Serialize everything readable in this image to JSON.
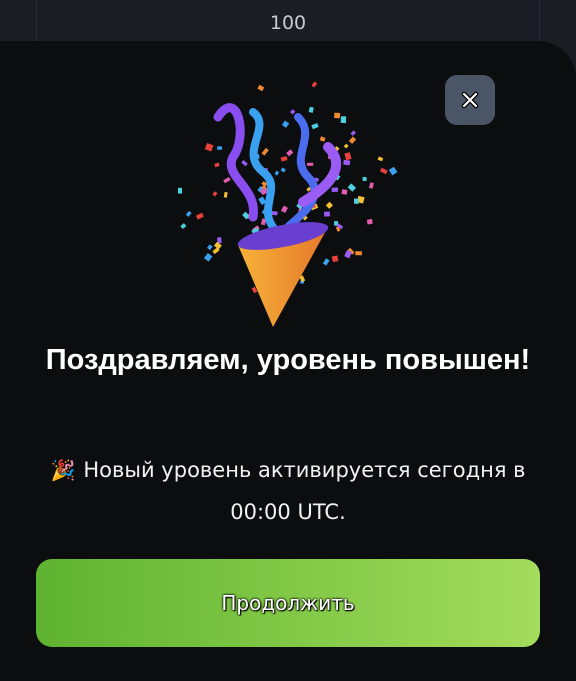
{
  "background": {
    "top_value": "100"
  },
  "modal": {
    "close_icon": "close-icon",
    "illustration": "party-popper",
    "title": "Поздравляем, уровень повышен!",
    "description_emoji": "🎉",
    "description": "Новый уровень активируется сегодня в 00:00 UTC.",
    "continue_label": "Продолжить"
  },
  "colors": {
    "button_start": "#5eb330",
    "button_end": "#a4dc5c",
    "close_bg": "#4a5566",
    "sheet_bg": "#0c0d0f"
  }
}
